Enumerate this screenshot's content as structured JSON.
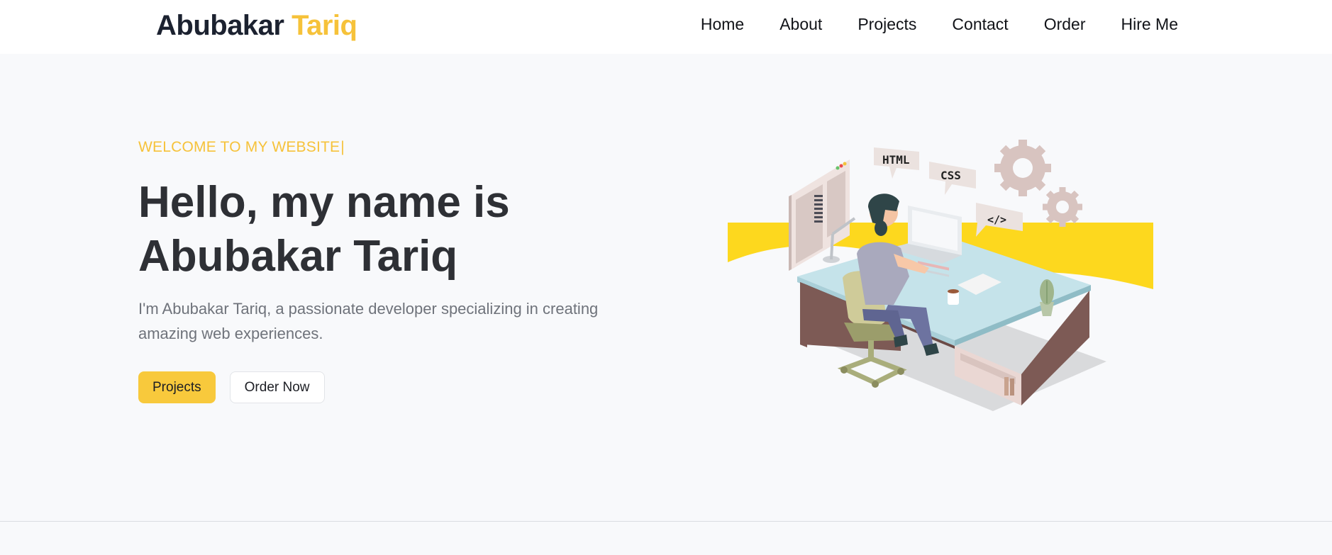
{
  "header": {
    "logo_first": "Abubakar",
    "logo_second": "Tariq",
    "nav": [
      "Home",
      "About",
      "Projects",
      "Contact",
      "Order",
      "Hire Me"
    ]
  },
  "hero": {
    "eyebrow": "WELCOME TO MY WEBSITE",
    "caret": "|",
    "headline_line1": "Hello, my name is",
    "headline_line2": "Abubakar Tariq",
    "subtext": "I'm Abubakar Tariq, a passionate developer specializing in creating amazing web experiences.",
    "primary_button": "Projects",
    "secondary_button": "Order Now"
  },
  "illustration": {
    "bubble_html": "HTML",
    "bubble_css": "CSS",
    "bubble_code": "</>"
  },
  "colors": {
    "accent": "#f6c23a",
    "button_primary": "#f8c93c",
    "band_yellow": "#fdd81e",
    "desk_top": "#c5e3ea",
    "desk_side": "#7d5a55"
  }
}
